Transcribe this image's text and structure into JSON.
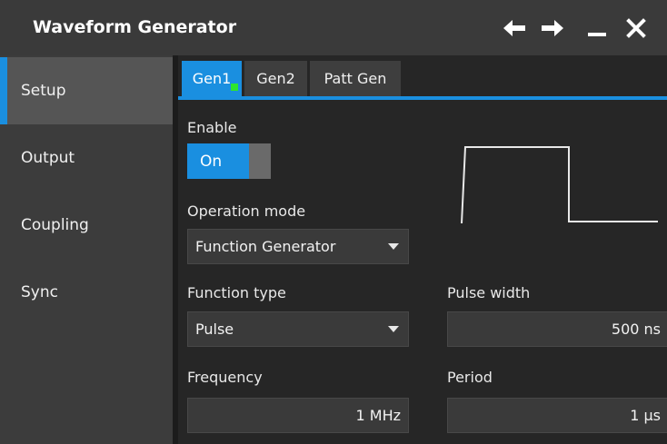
{
  "window": {
    "title": "Waveform Generator"
  },
  "sidebar": {
    "items": [
      {
        "label": "Setup",
        "active": true
      },
      {
        "label": "Output"
      },
      {
        "label": "Coupling"
      },
      {
        "label": "Sync"
      }
    ]
  },
  "tabs": [
    {
      "label": "Gen1",
      "active": true
    },
    {
      "label": "Gen2"
    },
    {
      "label": "Patt Gen"
    }
  ],
  "setup": {
    "enable_label": "Enable",
    "enable_state": "On",
    "operation_mode_label": "Operation mode",
    "operation_mode_value": "Function Generator",
    "function_type_label": "Function type",
    "function_type_value": "Pulse",
    "pulse_width_label": "Pulse width",
    "pulse_width_value": "500 ns",
    "frequency_label": "Frequency",
    "frequency_value": "1 MHz",
    "period_label": "Period",
    "period_value": "1 µs"
  },
  "icons": {
    "back": "arrow-left-icon",
    "forward": "arrow-right-icon",
    "minimize": "minimize-icon",
    "close": "close-icon"
  },
  "colors": {
    "accent": "#1a8fe0",
    "status_dot": "#2ee52e"
  }
}
